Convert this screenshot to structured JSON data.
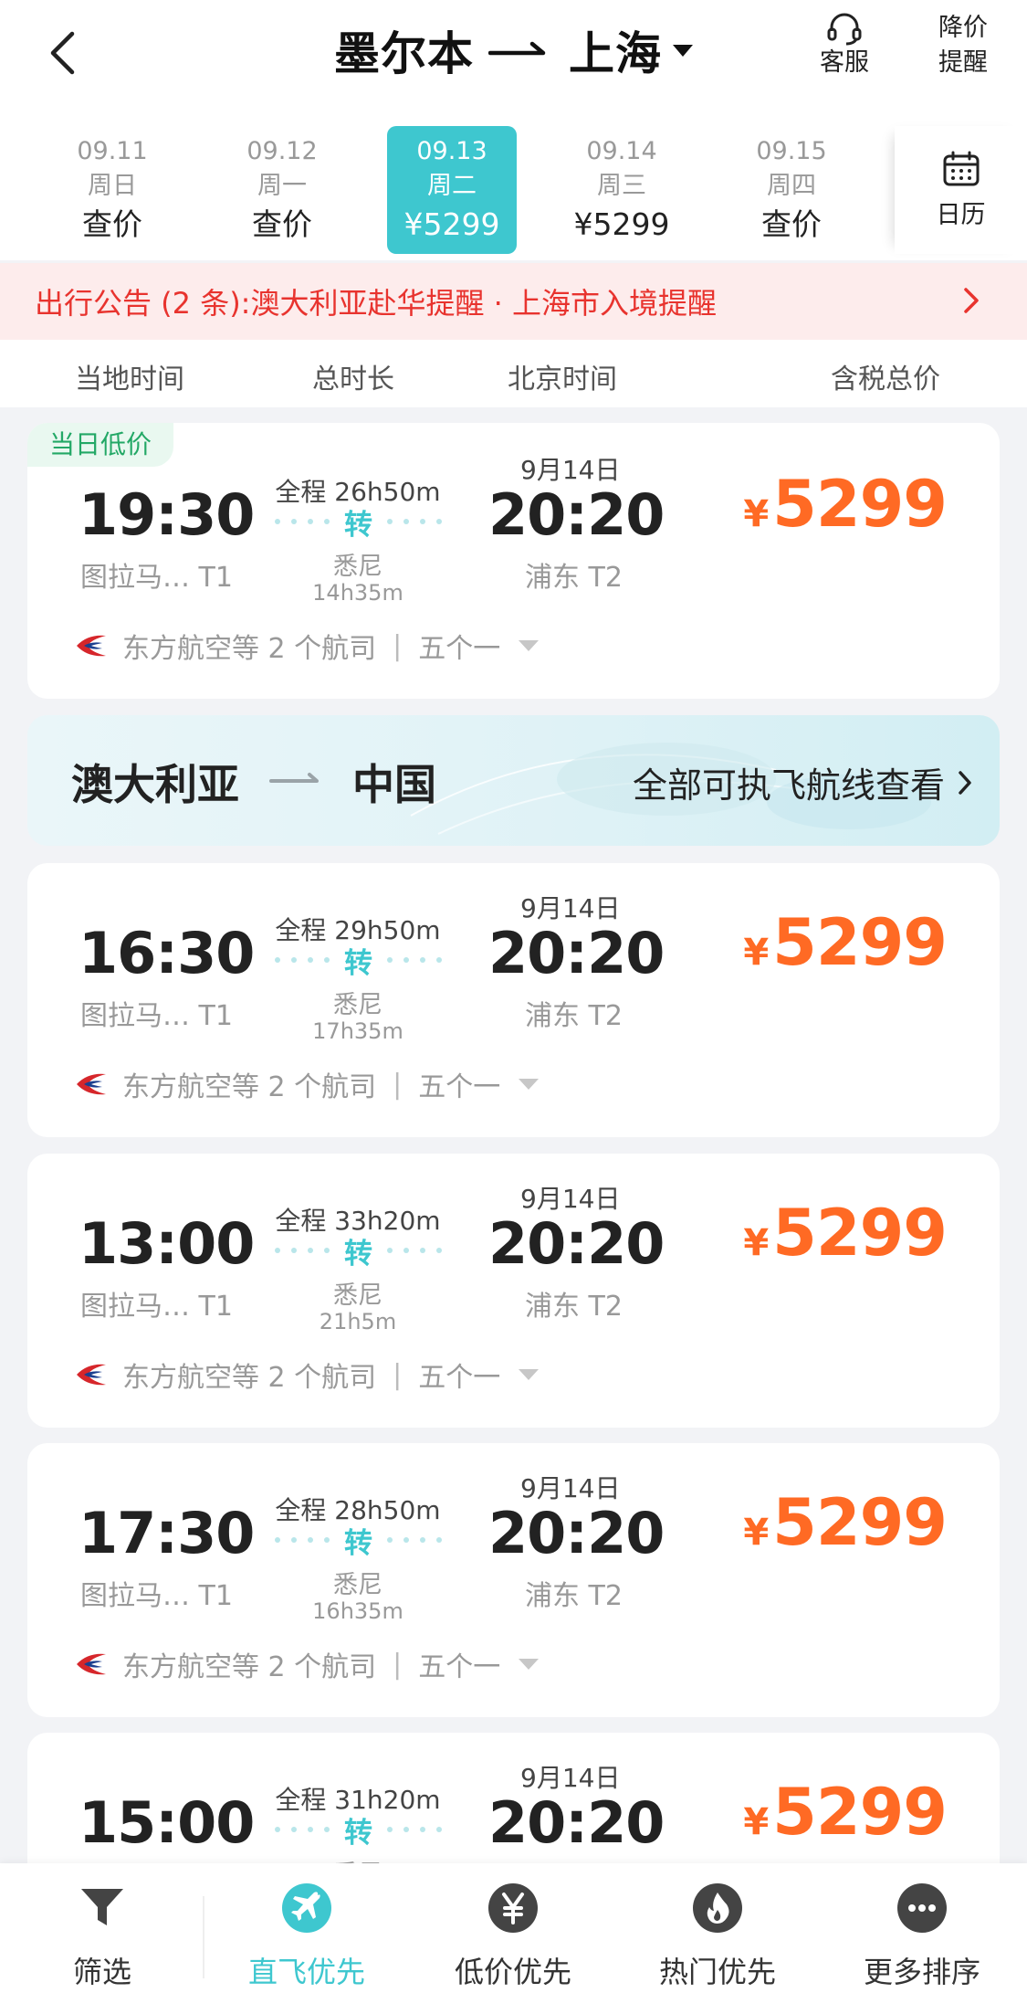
{
  "header": {
    "origin": "墨尔本",
    "destination": "上海",
    "service_label": "客服",
    "alert_label_line1": "降价",
    "alert_label_line2": "提醒"
  },
  "dates": [
    {
      "date": "09.11",
      "weekday": "周日",
      "price": "查价",
      "active": false
    },
    {
      "date": "09.12",
      "weekday": "周一",
      "price": "查价",
      "active": false
    },
    {
      "date": "09.13",
      "weekday": "周二",
      "price": "¥5299",
      "active": true
    },
    {
      "date": "09.14",
      "weekday": "周三",
      "price": "¥5299",
      "active": false
    },
    {
      "date": "09.15",
      "weekday": "周四",
      "price": "查价",
      "active": false
    }
  ],
  "calendar_label": "日历",
  "notice": {
    "text": "出行公告 (2 条):澳大利亚赴华提醒 · 上海市入境提醒"
  },
  "columns": {
    "local_time": "当地时间",
    "total_duration": "总时长",
    "beijing_time": "北京时间",
    "total_price": "含税总价"
  },
  "flights": [
    {
      "tag": "当日低价",
      "dep_time": "19:30",
      "dep_airport": "图拉马… T1",
      "duration": "全程 26h50m",
      "transfer": "转",
      "via": "悉尼",
      "layover": "14h35m",
      "arr_date": "9月14日",
      "arr_time": "20:20",
      "arr_airport": "浦东 T2",
      "currency": "¥",
      "price": "5299",
      "airline": "东方航空等 2 个航司",
      "meal": "五个一"
    },
    {
      "tag": "",
      "dep_time": "16:30",
      "dep_airport": "图拉马… T1",
      "duration": "全程 29h50m",
      "transfer": "转",
      "via": "悉尼",
      "layover": "17h35m",
      "arr_date": "9月14日",
      "arr_time": "20:20",
      "arr_airport": "浦东 T2",
      "currency": "¥",
      "price": "5299",
      "airline": "东方航空等 2 个航司",
      "meal": "五个一"
    },
    {
      "tag": "",
      "dep_time": "13:00",
      "dep_airport": "图拉马… T1",
      "duration": "全程 33h20m",
      "transfer": "转",
      "via": "悉尼",
      "layover": "21h5m",
      "arr_date": "9月14日",
      "arr_time": "20:20",
      "arr_airport": "浦东 T2",
      "currency": "¥",
      "price": "5299",
      "airline": "东方航空等 2 个航司",
      "meal": "五个一"
    },
    {
      "tag": "",
      "dep_time": "17:30",
      "dep_airport": "图拉马… T1",
      "duration": "全程 28h50m",
      "transfer": "转",
      "via": "悉尼",
      "layover": "16h35m",
      "arr_date": "9月14日",
      "arr_time": "20:20",
      "arr_airport": "浦东 T2",
      "currency": "¥",
      "price": "5299",
      "airline": "东方航空等 2 个航司",
      "meal": "五个一"
    },
    {
      "tag": "",
      "dep_time": "15:00",
      "dep_airport": "",
      "duration": "全程 31h20m",
      "transfer": "转",
      "via": "悉尼",
      "layover": "",
      "arr_date": "9月14日",
      "arr_time": "20:20",
      "arr_airport": "",
      "currency": "¥",
      "price": "5299",
      "airline": "",
      "meal": ""
    }
  ],
  "route_banner": {
    "from": "澳大利亚",
    "to": "中国",
    "view_all": "全部可执飞航线查看"
  },
  "bottom_tabs": [
    {
      "label": "筛选",
      "icon": "filter-icon",
      "active": false
    },
    {
      "label": "直飞优先",
      "icon": "airplane-icon",
      "active": true
    },
    {
      "label": "低价优先",
      "icon": "yen-icon",
      "active": false
    },
    {
      "label": "热门优先",
      "icon": "flame-icon",
      "active": false
    },
    {
      "label": "更多排序",
      "icon": "more-icon",
      "active": false
    }
  ],
  "colors": {
    "accent": "#3ec7cf",
    "price": "#ff6a24",
    "notice": "#e8332e",
    "low_price_tag": "#23a866"
  }
}
